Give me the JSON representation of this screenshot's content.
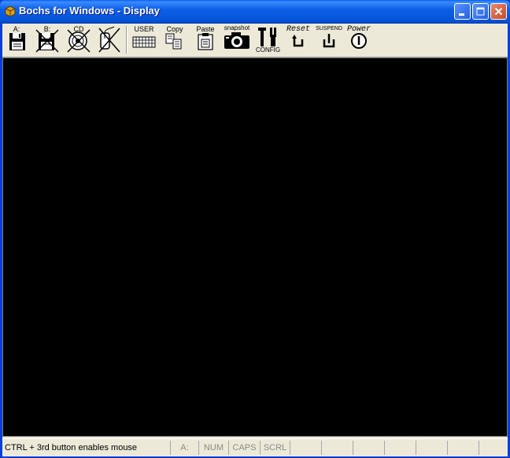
{
  "window": {
    "title": "Bochs for Windows - Display"
  },
  "toolbar": {
    "floppy_a_label": "A:",
    "floppy_b_label": "B:",
    "cdrom_label": "CD",
    "user_label": "USER",
    "copy_label": "Copy",
    "paste_label": "Paste",
    "snapshot_label": "snapshot",
    "config_label": "CONFIG",
    "reset_label": "Reset",
    "suspend_label": "SUSPEND",
    "power_label": "Power"
  },
  "statusbar": {
    "message": "CTRL + 3rd button enables mouse",
    "drive_indicator": "A:",
    "num_indicator": "NUM",
    "caps_indicator": "CAPS",
    "scrl_indicator": "SCRL"
  },
  "colors": {
    "titlebar": "#0553d8",
    "screen": "#000000",
    "chrome": "#ece9d8"
  },
  "icons": [
    "floppy-a-icon",
    "floppy-b-icon",
    "cdrom-icon",
    "mouse-icon",
    "keyboard-icon",
    "copy-icon",
    "paste-icon",
    "camera-icon",
    "config-icon",
    "reset-icon",
    "suspend-icon",
    "power-icon"
  ]
}
